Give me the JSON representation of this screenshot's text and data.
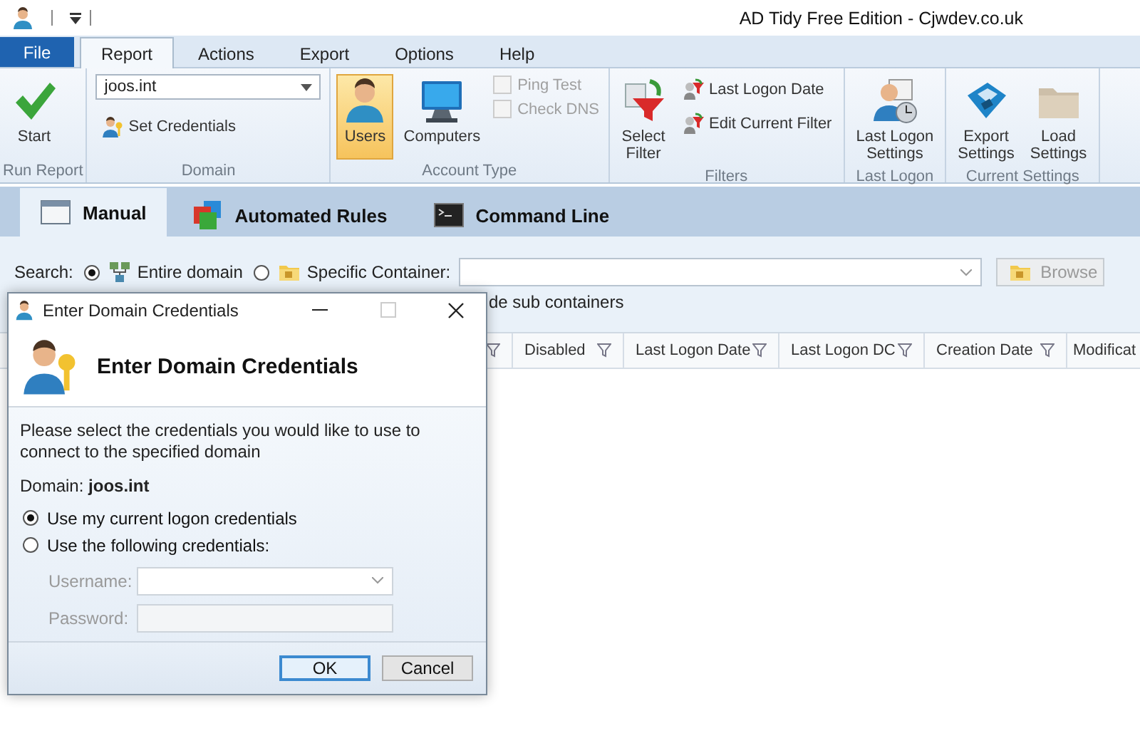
{
  "window": {
    "title": "AD Tidy Free Edition - Cjwdev.co.uk"
  },
  "menu_tabs": [
    {
      "label": "File",
      "kind": "file",
      "selected": false
    },
    {
      "label": "Report",
      "kind": "tab",
      "selected": true
    },
    {
      "label": "Actions",
      "kind": "tab",
      "selected": false
    },
    {
      "label": "Export",
      "kind": "tab",
      "selected": false
    },
    {
      "label": "Options",
      "kind": "tab",
      "selected": false
    },
    {
      "label": "Help",
      "kind": "tab",
      "selected": false
    }
  ],
  "ribbon": {
    "groups": [
      {
        "label": "Run Report",
        "items": [
          {
            "kind": "large",
            "label": "Start",
            "selected": false
          }
        ]
      },
      {
        "label": "Domain",
        "items": [
          {
            "kind": "combo",
            "value": "joos.int"
          },
          {
            "kind": "small",
            "label": "Set Credentials"
          }
        ]
      },
      {
        "label": "Account Type",
        "items": [
          {
            "kind": "large",
            "label": "Users",
            "selected": true
          },
          {
            "kind": "large",
            "label": "Computers",
            "selected": false
          },
          {
            "kind": "check",
            "label": "Ping Test",
            "checked": false,
            "disabled": true
          },
          {
            "kind": "check",
            "label": "Check DNS",
            "checked": false,
            "disabled": true
          }
        ]
      },
      {
        "label": "Filters",
        "items": [
          {
            "kind": "large",
            "label": "Select\nFilter",
            "selected": false
          },
          {
            "kind": "small",
            "label": "Last Logon Date"
          },
          {
            "kind": "small",
            "label": "Edit Current Filter"
          }
        ]
      },
      {
        "label": "Last Logon",
        "items": [
          {
            "kind": "large",
            "label": "Last Logon\nSettings",
            "selected": false
          }
        ]
      },
      {
        "label": "Current Settings",
        "items": [
          {
            "kind": "large",
            "label": "Export\nSettings",
            "selected": false
          },
          {
            "kind": "large",
            "label": "Load\nSettings",
            "selected": false
          }
        ]
      }
    ]
  },
  "view_tabs": [
    {
      "label": "Manual",
      "selected": true
    },
    {
      "label": "Automated Rules",
      "selected": false
    },
    {
      "label": "Command Line",
      "selected": false
    }
  ],
  "search": {
    "label": "Search:",
    "options": [
      {
        "label": "Entire domain",
        "selected": true
      },
      {
        "label": "Specific Container:",
        "selected": false
      }
    ],
    "browse": {
      "label": "Browse",
      "disabled": true
    },
    "sub_containers_text": "de sub containers"
  },
  "table": {
    "columns": [
      "",
      "Disabled",
      "Last Logon Date",
      "Last Logon DC",
      "Creation Date",
      "Modificat"
    ]
  },
  "dialog": {
    "title": "Enter Domain Credentials",
    "maximize_disabled": true,
    "heading": "Enter Domain Credentials",
    "description": "Please select the credentials you would like to use to connect to the specified domain",
    "domain": "Domain:  **joos.int**",
    "options": [
      {
        "label": "Use my current logon credentials",
        "selected": true
      },
      {
        "label": "Use the following credentials:",
        "selected": false
      }
    ],
    "fields": [
      {
        "label": "Username:",
        "kind": "combo",
        "disabled": true
      },
      {
        "label": "Password:",
        "kind": "text",
        "disabled": true
      }
    ],
    "buttons": [
      {
        "label": "OK",
        "default": true
      },
      {
        "label": "Cancel",
        "default": false
      }
    ]
  }
}
